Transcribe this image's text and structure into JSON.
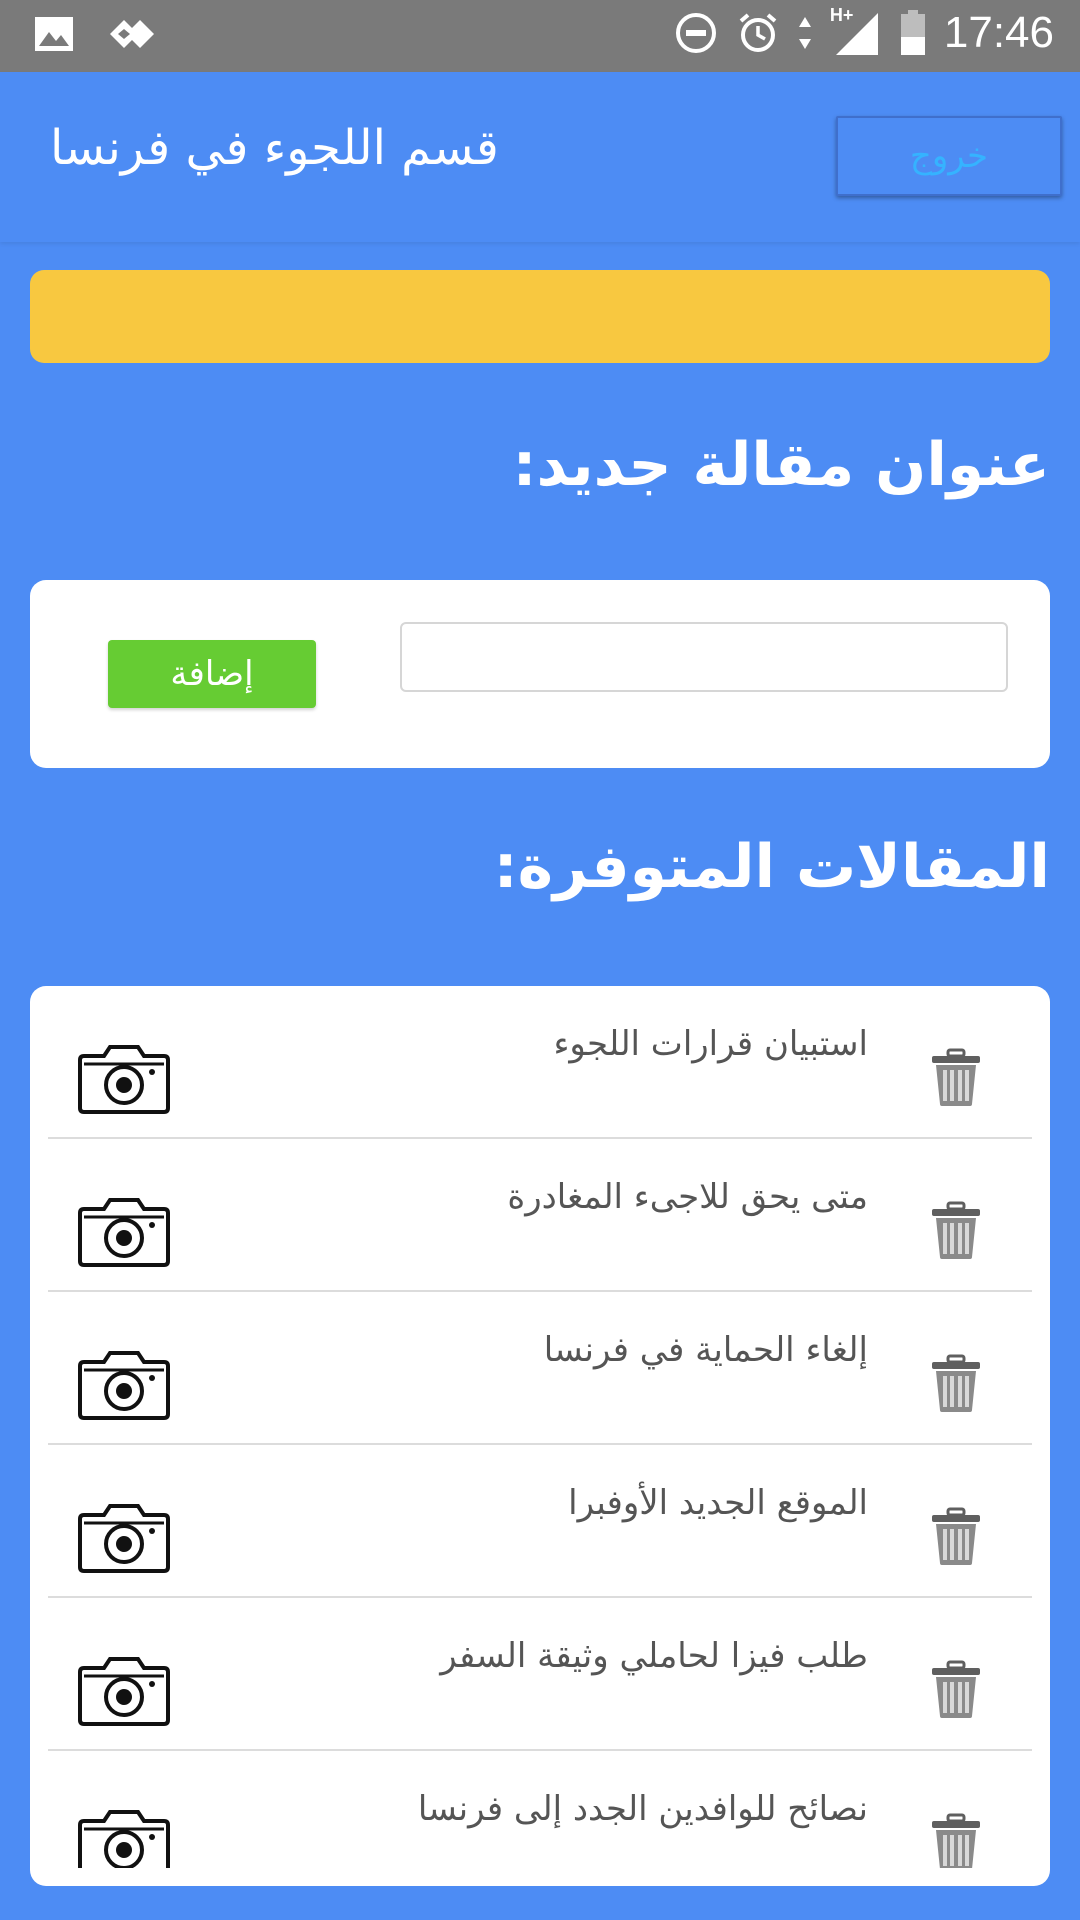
{
  "status_bar": {
    "time": "17:46",
    "network": "H+",
    "icons_left": [
      "image-icon",
      "app-notification-icon"
    ],
    "icons_right": [
      "do-not-disturb-icon",
      "alarm-icon",
      "data-arrows-icon",
      "signal-icon",
      "battery-icon"
    ]
  },
  "header": {
    "title": "قسم اللجوء في فرنسا",
    "logout_label": "خروج"
  },
  "new_article": {
    "heading": "عنوان مقالة جديد:",
    "input_value": "",
    "input_placeholder": "",
    "add_label": "إضافة"
  },
  "articles": {
    "heading": "المقالات المتوفرة:",
    "items": [
      {
        "title": "استبيان قرارات اللجوء"
      },
      {
        "title": "متى يحق للاجىء المغادرة"
      },
      {
        "title": "إلغاء الحماية في فرنسا"
      },
      {
        "title": "الموقع الجديد الأوفبرا"
      },
      {
        "title": "طلب فيزا لحاملي وثيقة السفر"
      },
      {
        "title": "نصائح للوافدين الجدد إلى فرنسا"
      }
    ]
  },
  "colors": {
    "background": "#4d8cf4",
    "notice_bar": "#f8c840",
    "add_button": "#66cc33",
    "logout_text": "#35b3ff",
    "status_bar": "#7a7a7a"
  }
}
